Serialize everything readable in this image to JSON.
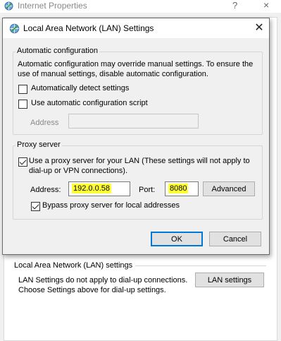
{
  "background_window": {
    "title": "Internet Properties",
    "help_glyph": "?",
    "close_glyph": "×",
    "lan_section": {
      "title": "Local Area Network (LAN) settings",
      "description": "LAN Settings do not apply to dial-up connections. Choose Settings above for dial-up settings.",
      "button_label": "LAN settings"
    }
  },
  "dialog": {
    "title": "Local Area Network (LAN) Settings",
    "close_glyph": "✕",
    "automatic_configuration": {
      "group_title": "Automatic configuration",
      "description": "Automatic configuration may override manual settings.  To ensure the use of manual settings, disable automatic configuration.",
      "auto_detect": {
        "label": "Automatically detect settings",
        "checked": false
      },
      "use_script": {
        "label": "Use automatic configuration script",
        "checked": false
      },
      "address_label": "Address",
      "address_value": ""
    },
    "proxy_server": {
      "group_title": "Proxy server",
      "use_proxy": {
        "label_line1": "Use a proxy server for your LAN (These settings will not apply to",
        "label_line2": "dial-up or VPN connections).",
        "checked": true
      },
      "address_label": "Address:",
      "address_value": "192.0.0.58",
      "port_label": "Port:",
      "port_value": "8080",
      "advanced_label": "Advanced",
      "bypass_local": {
        "label": "Bypass proxy server for local addresses",
        "checked": true
      }
    },
    "ok_label": "OK",
    "cancel_label": "Cancel"
  },
  "colors": {
    "highlight": "#ffff33",
    "default_button_border": "#0078d7",
    "window_background": "#f0f0f0"
  },
  "icons": {
    "window_icon": "internet-globe-icon",
    "dialog_icon": "internet-globe-icon"
  }
}
